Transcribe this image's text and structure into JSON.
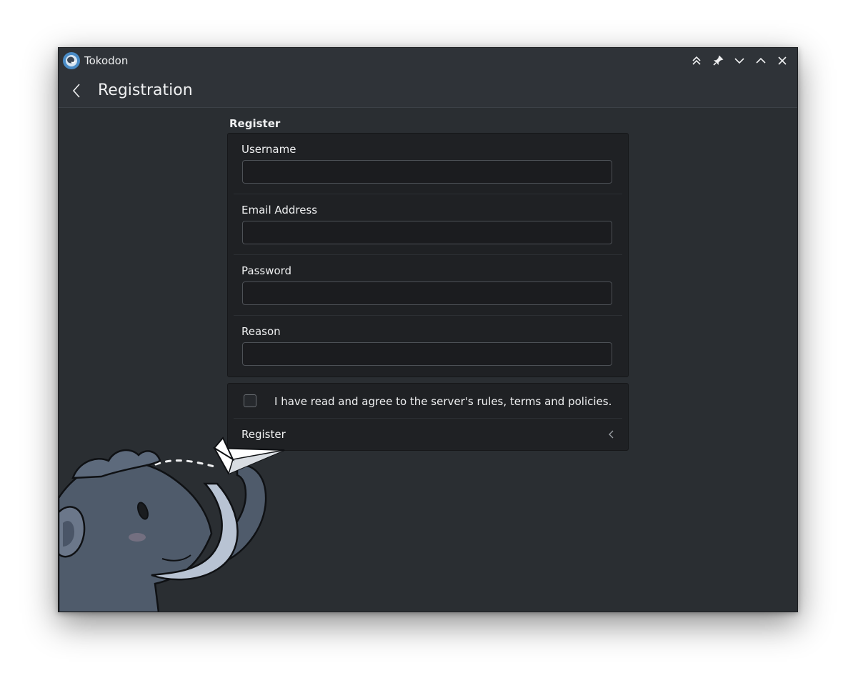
{
  "window": {
    "title": "Tokodon"
  },
  "header": {
    "title": "Registration"
  },
  "form": {
    "section_title": "Register",
    "fields": [
      {
        "label": "Username",
        "value": ""
      },
      {
        "label": "Email Address",
        "value": ""
      },
      {
        "label": "Password",
        "value": ""
      },
      {
        "label": "Reason",
        "value": ""
      }
    ]
  },
  "actions": {
    "agree_text": "I have read and agree to the server's rules, terms and policies.",
    "agree_checked": false,
    "register_label": "Register"
  },
  "icons": {
    "titlebar": [
      "keep-above-icon",
      "pin-icon",
      "minimize-icon",
      "maximize-icon",
      "close-icon"
    ],
    "header": "back-arrow-icon",
    "register": "chevron-left-icon"
  },
  "colors": {
    "window_bg": "#2a2e32",
    "card_bg": "#1f2124",
    "text": "#eff0f1",
    "app_icon": "#4a8cc7"
  }
}
